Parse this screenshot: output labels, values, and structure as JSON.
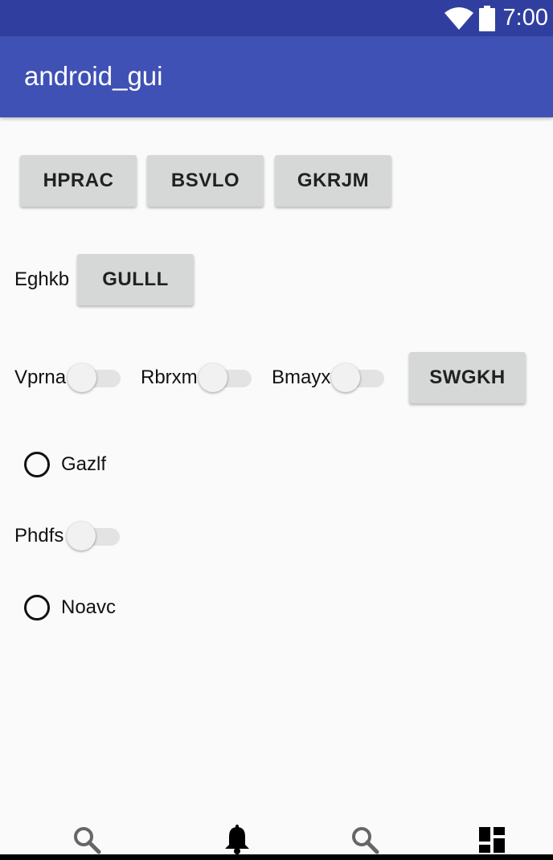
{
  "status_bar": {
    "time": "7:00",
    "icons": [
      "wifi-icon",
      "battery-icon"
    ]
  },
  "app_bar": {
    "title": "android_gui"
  },
  "buttons": {
    "hprac": "HPRAC",
    "bsvlo": "BSVLO",
    "gkrjm": "GKRJM",
    "gulll": "GULLL",
    "swgkh": "SWGKH"
  },
  "labels": {
    "eghkb": "Eghkb"
  },
  "switches": {
    "vprna": {
      "label": "Vprna",
      "checked": false
    },
    "rbrxm": {
      "label": "Rbrxm",
      "checked": false
    },
    "bmayx": {
      "label": "Bmayx",
      "checked": false
    },
    "phdfs": {
      "label": "Phdfs",
      "checked": false
    }
  },
  "radios": {
    "gazlf": {
      "label": "Gazlf",
      "checked": false
    },
    "noavc": {
      "label": "Noavc",
      "checked": false
    }
  },
  "bottom_nav": {
    "items": [
      "search-icon",
      "bell-icon",
      "search-icon",
      "dashboard-icon"
    ]
  },
  "colors": {
    "status_bar": "#303f9f",
    "app_bar": "#3f51b5",
    "background": "#fafafa",
    "button": "#d6d7d7"
  }
}
